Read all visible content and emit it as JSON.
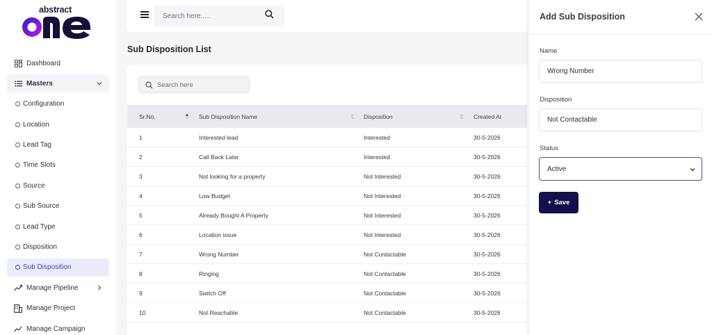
{
  "brand": {
    "top": "abstract",
    "main": "one"
  },
  "sidebar": {
    "items": [
      {
        "label": "Dashboard"
      },
      {
        "label": "Masters"
      },
      {
        "label": "Configuration"
      },
      {
        "label": "Location"
      },
      {
        "label": "Lead Tag"
      },
      {
        "label": "Time Slots"
      },
      {
        "label": "Source"
      },
      {
        "label": "Sub Source"
      },
      {
        "label": "Lead Type"
      },
      {
        "label": "Disposition"
      },
      {
        "label": "Sub Disposition"
      },
      {
        "label": "Manage Pipeline"
      },
      {
        "label": "Manage Project"
      },
      {
        "label": "Manage Campaign"
      }
    ]
  },
  "topbar": {
    "search_placeholder": "Search here....."
  },
  "page": {
    "title": "Sub Disposition List"
  },
  "table": {
    "search_placeholder": "Search here",
    "headers": [
      "Sr.No.",
      "Sub Disposition Name",
      "Disposition",
      "Created At"
    ],
    "rows": [
      [
        "1",
        "Interested lead",
        "Interested",
        "30-5-2026"
      ],
      [
        "2",
        "Call Back Later",
        "Interested",
        "30-5-2026"
      ],
      [
        "3",
        "Not looking for a property",
        "Not Interested",
        "30-5-2026"
      ],
      [
        "4",
        "Low Budget",
        "Not Interested",
        "30-5-2026"
      ],
      [
        "5",
        "Already Bought A Property",
        "Not Interested",
        "30-5-2026"
      ],
      [
        "6",
        "Location issue",
        "Not Interested",
        "30-5-2026"
      ],
      [
        "7",
        "Wrong Number",
        "Not Contactable",
        "30-5-2026"
      ],
      [
        "8",
        "Ringing",
        "Not Contactable",
        "30-5-2026"
      ],
      [
        "9",
        "Switch Off",
        "Not Contactable",
        "30-5-2026"
      ],
      [
        "10",
        "Not Reachable",
        "Not Contactable",
        "30-5-2026"
      ]
    ]
  },
  "panel": {
    "title": "Add Sub Disposition",
    "name_label": "Name",
    "name_value": "Wrong Number",
    "disposition_label": "Disposition",
    "disposition_value": "Not Contactable",
    "status_label": "Status",
    "status_value": "Active",
    "save_label": "Save",
    "save_icon": "+"
  },
  "colors": {
    "accent": "#3f45c9",
    "button": "#13104a",
    "logo_gradient_start": "#2a1fd1",
    "logo_gradient_end": "#c51bd6"
  }
}
